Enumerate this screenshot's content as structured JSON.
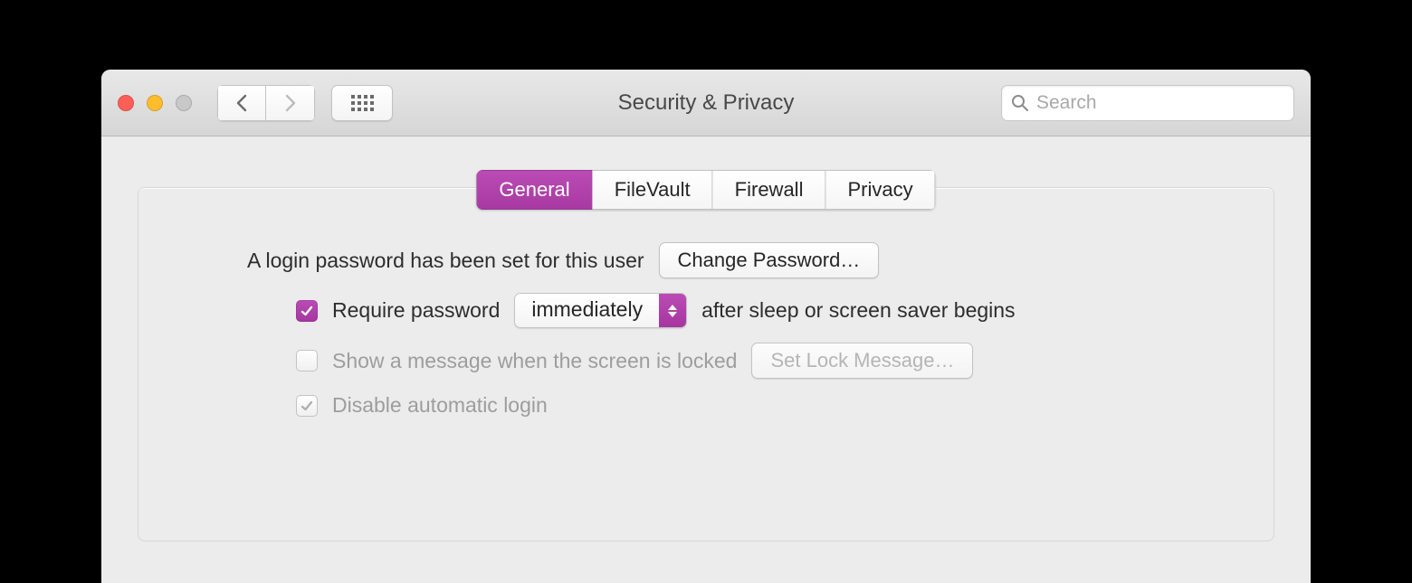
{
  "window": {
    "title": "Security & Privacy"
  },
  "search": {
    "placeholder": "Search"
  },
  "tabs": [
    {
      "label": "General",
      "active": true
    },
    {
      "label": "FileVault",
      "active": false
    },
    {
      "label": "Firewall",
      "active": false
    },
    {
      "label": "Privacy",
      "active": false
    }
  ],
  "login_row": {
    "text": "A login password has been set for this user",
    "button": "Change Password…"
  },
  "require_row": {
    "pre": "Require password",
    "select_value": "immediately",
    "post": "after sleep or screen saver begins",
    "checked": true
  },
  "lockmsg_row": {
    "text": "Show a message when the screen is locked",
    "button": "Set Lock Message…",
    "checked": false,
    "disabled": true
  },
  "autologin_row": {
    "text": "Disable automatic login",
    "checked": true,
    "disabled": true
  },
  "accent": "#b346ae"
}
